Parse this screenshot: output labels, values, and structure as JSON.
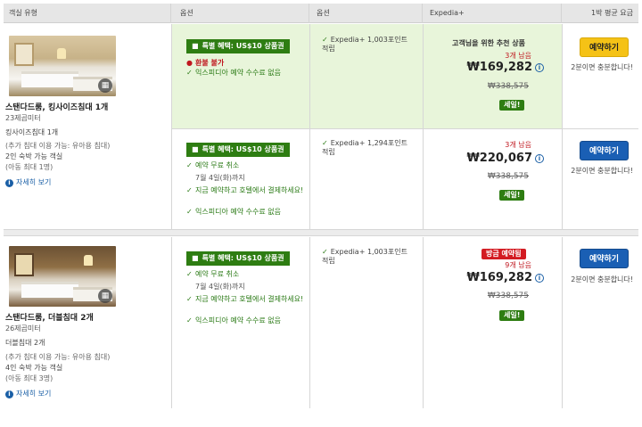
{
  "header": {
    "col_room": "객실 유형",
    "col_options": "옵션",
    "col_options2": "옵션",
    "col_expedia": "Expedia+",
    "col_price": "1박 평균 요금"
  },
  "rooms": [
    {
      "name": "스탠다드룸, 킹사이즈침대 1개",
      "size": "23제곱미터",
      "bed": "킹사이즈침대 1개",
      "extra_bed": "(추가 침대 이용 가능: 유아용 침대)",
      "occupancy": "2인 숙박 가능 객실",
      "kids": "(아동 최대 1명)",
      "details": "자세히 보기",
      "gallery_icon": "grid-icon",
      "rates": [
        {
          "badge": "특별 혜택: US$10 상품권",
          "options": [
            {
              "icon": "alert-icon",
              "text": "환불 불가",
              "type": "red"
            },
            {
              "icon": "check-icon",
              "text": "익스피디아 예약 수수료 없음",
              "type": "green"
            }
          ],
          "points": "Expedia+ 1,003포인트 적립",
          "recommend": "고객님을 위한 추천 상품",
          "left": "3개 남음",
          "price": "₩169,282",
          "strike": "₩338,575",
          "sale": "세일!",
          "book": "예약하기",
          "book_style": "yellow",
          "note": "2분이면 충분합니다!"
        },
        {
          "badge": "특별 혜택: US$10 상품권",
          "options": [
            {
              "icon": "check-icon",
              "text": "예약 무료 취소",
              "type": "green"
            },
            {
              "icon": "",
              "text": "7월 4일(화)까지",
              "type": "sub"
            },
            {
              "icon": "check-icon",
              "text": "지금 예약하고 호텔에서 결제하세요!",
              "type": "green-wrap"
            },
            {
              "icon": "check-icon",
              "text": "익스피디아 예약 수수료 없음",
              "type": "green"
            }
          ],
          "points": "Expedia+ 1,294포인트 적립",
          "left": "3개 남음",
          "price": "₩220,067",
          "strike": "₩338,575",
          "sale": "세일!",
          "book": "예약하기",
          "book_style": "blue",
          "note": "2분이면 충분합니다!"
        }
      ]
    },
    {
      "name": "스탠다드룸, 더블침대 2개",
      "size": "26제곱미터",
      "bed": "더블침대 2개",
      "extra_bed": "(추가 침대 이용 가능: 유아용 침대)",
      "occupancy": "4인 숙박 가능 객실",
      "kids": "(아동 최대 3명)",
      "details": "자세히 보기",
      "gallery_icon": "grid-icon",
      "rates": [
        {
          "badge": "특별 혜택: US$10 상품권",
          "options": [
            {
              "icon": "check-icon",
              "text": "예약 무료 취소",
              "type": "green"
            },
            {
              "icon": "",
              "text": "7월 4일(화)까지",
              "type": "sub"
            },
            {
              "icon": "check-icon",
              "text": "지금 예약하고 호텔에서 결제하세요!",
              "type": "green-wrap"
            },
            {
              "icon": "check-icon",
              "text": "익스피디아 예약 수수료 없음",
              "type": "green"
            }
          ],
          "points": "Expedia+ 1,003포인트 적립",
          "hot": "방금 예약됨",
          "left": "9개 남음",
          "price": "₩169,282",
          "strike": "₩338,575",
          "sale": "세일!",
          "book": "예약하기",
          "book_style": "blue",
          "note": "2분이면 충분합니다!"
        }
      ]
    }
  ],
  "colors": {
    "highlight_bg": "#e8f5da",
    "sale_green": "#2e7d12",
    "book_yellow": "#f5c216",
    "book_blue": "#1a5fb4",
    "alert_red": "#c0171f"
  }
}
